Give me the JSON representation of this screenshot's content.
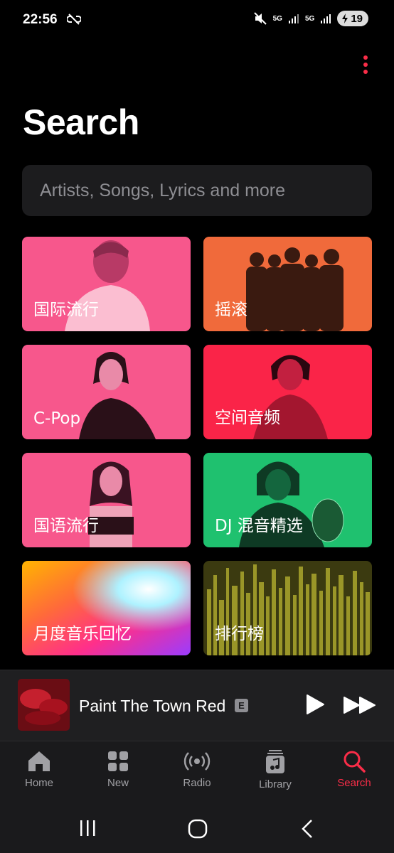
{
  "status": {
    "time": "22:56",
    "battery": "19",
    "network1": "5G",
    "network2": "5G"
  },
  "page": {
    "title": "Search"
  },
  "search": {
    "placeholder": "Artists, Songs, Lyrics and more"
  },
  "tiles": [
    {
      "label": "国际流行",
      "color": "#f7578c"
    },
    {
      "label": "摇滚",
      "color": "#f06a3b"
    },
    {
      "label": "C-Pop",
      "color": "#f7578c"
    },
    {
      "label": "空间音频",
      "color": "#fa2448"
    },
    {
      "label": "国语流行",
      "color": "#f7578c"
    },
    {
      "label": "DJ 混音精选",
      "color": "#1fc16f"
    },
    {
      "label": "月度音乐回忆",
      "color": "#ff3aa0"
    },
    {
      "label": "排行榜",
      "color": "#6d6b1c"
    }
  ],
  "now_playing": {
    "title": "Paint The Town Red",
    "explicit": "E"
  },
  "tabs": [
    {
      "label": "Home",
      "icon": "home-icon"
    },
    {
      "label": "New",
      "icon": "grid-icon"
    },
    {
      "label": "Radio",
      "icon": "radio-icon"
    },
    {
      "label": "Library",
      "icon": "library-icon"
    },
    {
      "label": "Search",
      "icon": "search-icon",
      "active": true
    }
  ],
  "colors": {
    "accent": "#fa2d48",
    "background": "#000000",
    "surface": "#1c1c1e"
  }
}
